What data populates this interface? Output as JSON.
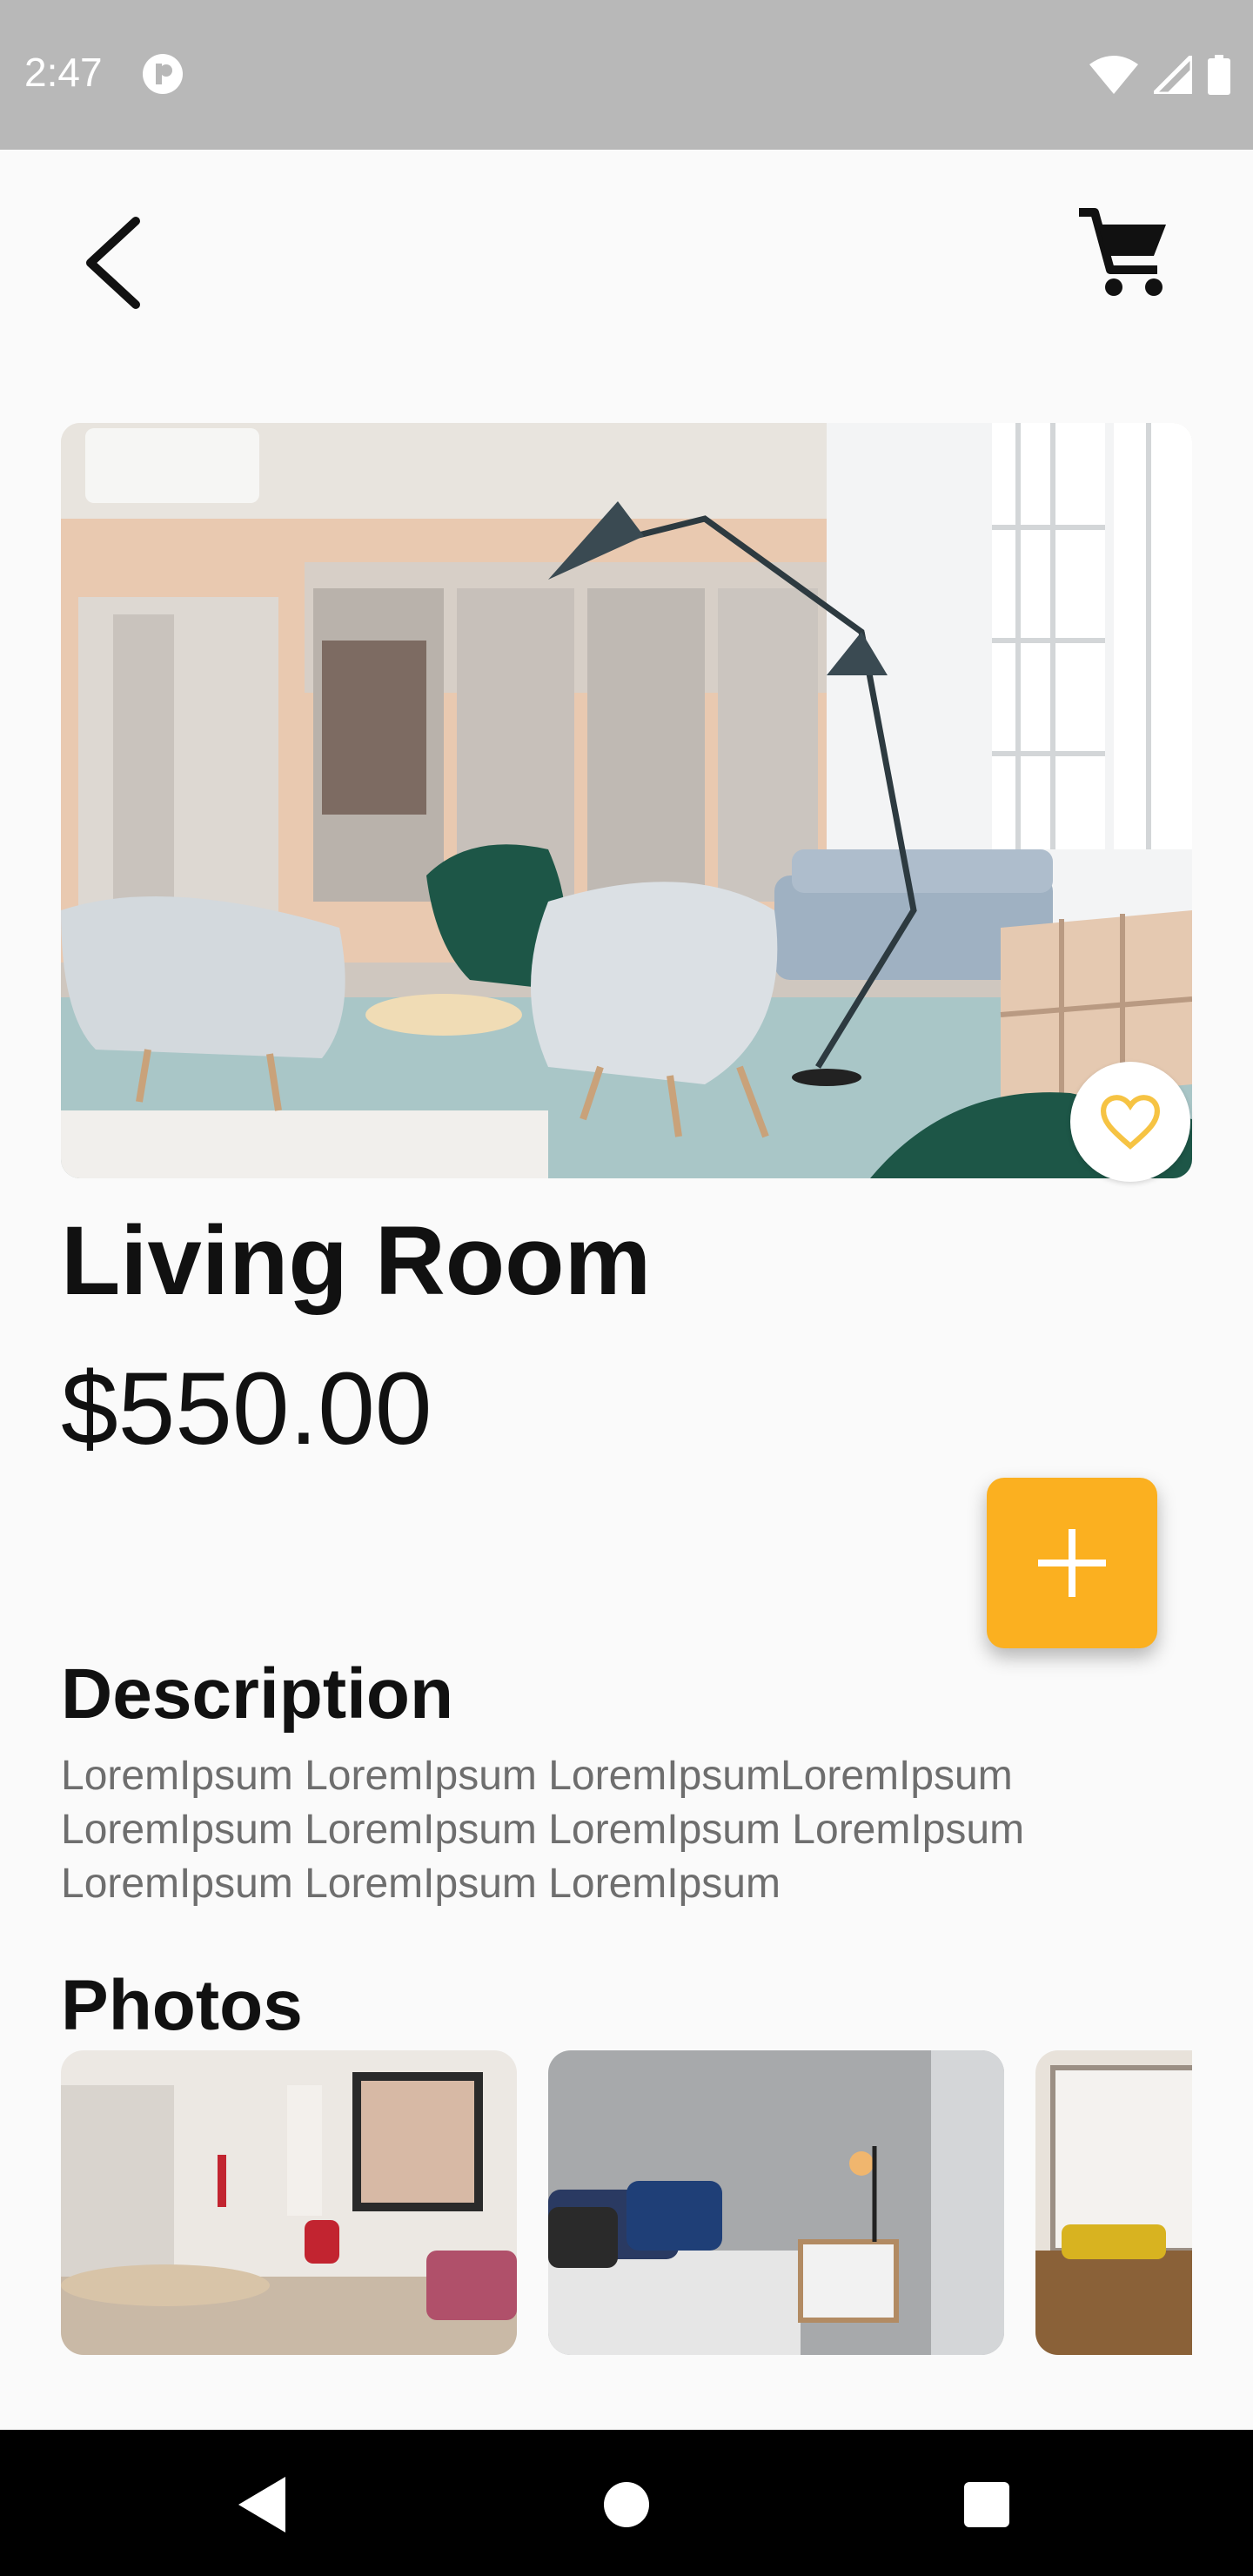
{
  "status_bar": {
    "time": "2:47"
  },
  "header": {
    "back_icon": "arrow-back-icon",
    "cart_icon": "shopping-cart-icon"
  },
  "product": {
    "title": "Living Room",
    "price": "$550.00",
    "favorite_icon": "heart-outline-icon",
    "add_icon": "plus-icon"
  },
  "description": {
    "heading": "Description",
    "text": "LoremIpsum LoremIpsum LoremIpsumLoremIpsum LoremIpsum LoremIpsum LoremIpsum LoremIpsum LoremIpsum LoremIpsum LoremIpsum"
  },
  "photos": {
    "heading": "Photos",
    "items": [
      "kitchen-dining-photo",
      "bedroom-photo",
      "window-seat-photo"
    ]
  },
  "colors": {
    "accent": "#fbb020",
    "favorite": "#f6c343",
    "background": "#fafafa",
    "status_bar": "#b8b8b8"
  }
}
